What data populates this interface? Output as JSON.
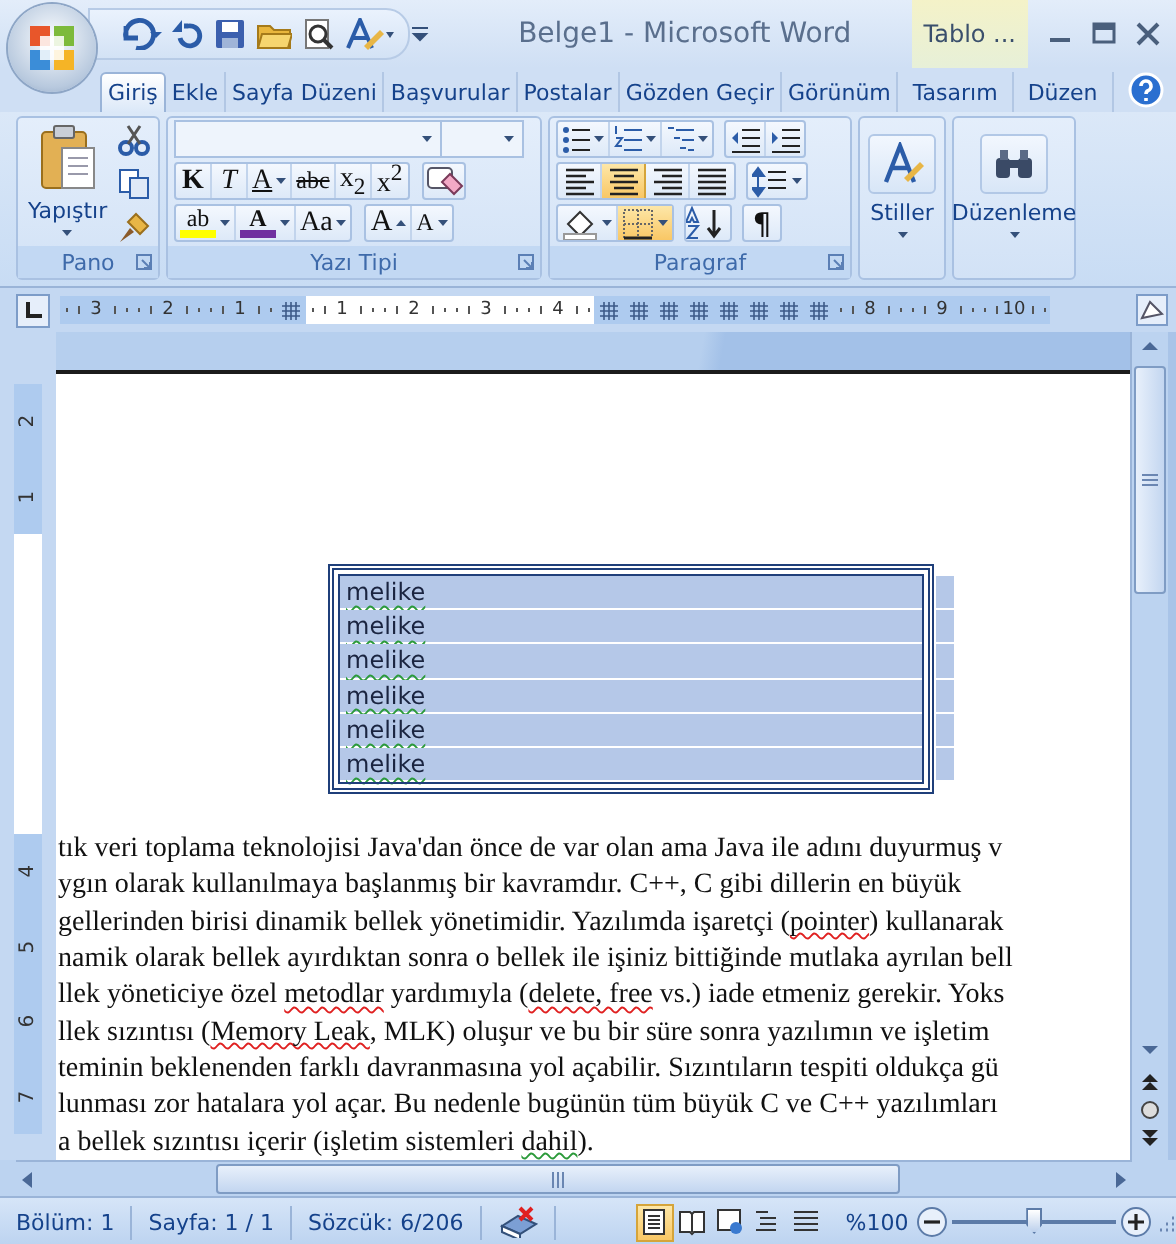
{
  "title_bar": {
    "title": "Belge1 - Microsoft Word",
    "context_tab": "Tablo ..."
  },
  "tabs": [
    {
      "label": "Giriş",
      "selected": true
    },
    {
      "label": "Ekle",
      "selected": false
    },
    {
      "label": "Sayfa Düzeni",
      "selected": false
    },
    {
      "label": "Başvurular",
      "selected": false
    },
    {
      "label": "Postalar",
      "selected": false
    },
    {
      "label": "Gözden Geçir",
      "selected": false
    },
    {
      "label": "Görünüm",
      "selected": false
    },
    {
      "label": "Tasarım",
      "selected": false
    },
    {
      "label": "Düzen",
      "selected": false
    }
  ],
  "ribbon": {
    "clipboard": {
      "title": "Pano",
      "paste": "Yapıştır"
    },
    "font": {
      "title": "Yazı Tipi",
      "row1": [
        {
          "label": "K",
          "kind": "bold"
        },
        {
          "label": "T",
          "kind": "italic"
        },
        {
          "label": "A",
          "kind": "underline"
        },
        {
          "label": "abc",
          "kind": "strike"
        },
        {
          "label": "x$_{2}$",
          "kind": "plain"
        },
        {
          "label": "x$^{2}$",
          "kind": "plain"
        }
      ],
      "row2": [
        {
          "label": "ab",
          "kind": "highlight",
          "color": "#ffff00"
        },
        {
          "label": "A",
          "kind": "color",
          "color": "#7030a0"
        },
        {
          "label": "Aa",
          "kind": "plain"
        },
        {
          "label": "A",
          "kind": "grow"
        },
        {
          "label": "A",
          "kind": "shrink"
        }
      ]
    },
    "paragraph": {
      "title": "Paragraf",
      "alignments": [
        {
          "selected": false
        },
        {
          "selected": true
        },
        {
          "selected": false
        },
        {
          "selected": false
        }
      ],
      "borders": {
        "selected": true
      },
      "marks_label": "¶"
    },
    "styles": {
      "title": "Stiller"
    },
    "editing": {
      "title": "Düzenleme"
    }
  },
  "ruler": [
    {
      "kind": "number",
      "label": "3"
    },
    {
      "kind": "number",
      "label": "2"
    },
    {
      "kind": "number",
      "label": "1"
    },
    {
      "kind": "column"
    },
    {
      "kind": "number",
      "label": "1"
    },
    {
      "kind": "number",
      "label": "2"
    },
    {
      "kind": "number",
      "label": "3"
    },
    {
      "kind": "number",
      "label": "4"
    },
    {
      "kind": "column"
    },
    {
      "kind": "column"
    },
    {
      "kind": "column"
    },
    {
      "kind": "column"
    },
    {
      "kind": "column"
    },
    {
      "kind": "column"
    },
    {
      "kind": "column"
    },
    {
      "kind": "column"
    },
    {
      "kind": "number",
      "label": "8"
    },
    {
      "kind": "number",
      "label": "9"
    },
    {
      "kind": "number",
      "label": "10"
    }
  ],
  "vertical_ruler": [
    {
      "kind": "number",
      "label": "2"
    },
    {
      "kind": "number",
      "label": "1"
    },
    {
      "kind": "blank"
    },
    {
      "kind": "blank"
    },
    {
      "kind": "blank"
    },
    {
      "kind": "blank"
    },
    {
      "kind": "number",
      "label": "4"
    },
    {
      "kind": "number",
      "label": "5"
    },
    {
      "kind": "number",
      "label": "6"
    },
    {
      "kind": "number",
      "label": "7"
    }
  ],
  "table": {
    "rows": [
      {
        "cell": "melike",
        "selected": true
      },
      {
        "cell": "melike",
        "selected": true
      },
      {
        "cell": "melike",
        "selected": true
      },
      {
        "cell": "melike",
        "selected": true
      },
      {
        "cell": "melike",
        "selected": true
      },
      {
        "cell": "melike",
        "selected": true
      }
    ]
  },
  "paragraph_lines": [
    [
      {
        "text": "tık veri toplama teknolojisi Java'dan önce de var olan ama Java ile adını duyurmuş v",
        "kind": "plain"
      }
    ],
    [
      {
        "text": "ygın olarak kullanılmaya başlanmış bir kavramdır. C++, C gibi dillerin en büyük",
        "kind": "plain"
      }
    ],
    [
      {
        "text": "gellerinden birisi dinamik bellek yönetimidir. Yazılımda işaretçi (",
        "kind": "plain"
      },
      {
        "text": "pointer",
        "kind": "spelling"
      },
      {
        "text": ") kullanarak",
        "kind": "plain"
      }
    ],
    [
      {
        "text": "namik olarak bellek ayırdıktan sonra o bellek ile işiniz bittiğinde mutlaka ayrılan bell",
        "kind": "plain"
      }
    ],
    [
      {
        "text": "llek yöneticiye özel ",
        "kind": "plain"
      },
      {
        "text": "metodlar",
        "kind": "spelling"
      },
      {
        "text": " yardımıyla (",
        "kind": "plain"
      },
      {
        "text": "delete, free",
        "kind": "spelling"
      },
      {
        "text": " vs.) iade etmeniz gerekir. Yoks",
        "kind": "plain"
      }
    ],
    [
      {
        "text": "llek sızıntısı (",
        "kind": "plain"
      },
      {
        "text": "Memory Leak",
        "kind": "spelling"
      },
      {
        "text": ", MLK) oluşur ve bu bir süre sonra yazılımın ve işletim",
        "kind": "plain"
      }
    ],
    [
      {
        "text": "teminin beklenenden farklı davranmasına yol açabilir. Sızıntıların tespiti oldukça gü",
        "kind": "plain"
      }
    ],
    [
      {
        "text": "lunması zor hatalara yol açar. Bu nedenle bugünün tüm büyük C ve C++ yazılımları",
        "kind": "plain"
      }
    ],
    [
      {
        "text": "a bellek sızıntısı içerir (işletim sistemleri ",
        "kind": "plain"
      },
      {
        "text": "dahil",
        "kind": "grammar"
      },
      {
        "text": ").",
        "kind": "plain"
      }
    ]
  ],
  "status_bar": {
    "section": "Bölüm: 1",
    "page": "Sayfa: 1 / 1",
    "words": "Sözcük: 6/206",
    "views": [
      {
        "selected": true
      },
      {
        "selected": false
      },
      {
        "selected": false
      },
      {
        "selected": false
      },
      {
        "selected": false
      }
    ],
    "zoom": "%100",
    "zoom_slider": {
      "level": 0.5
    }
  }
}
